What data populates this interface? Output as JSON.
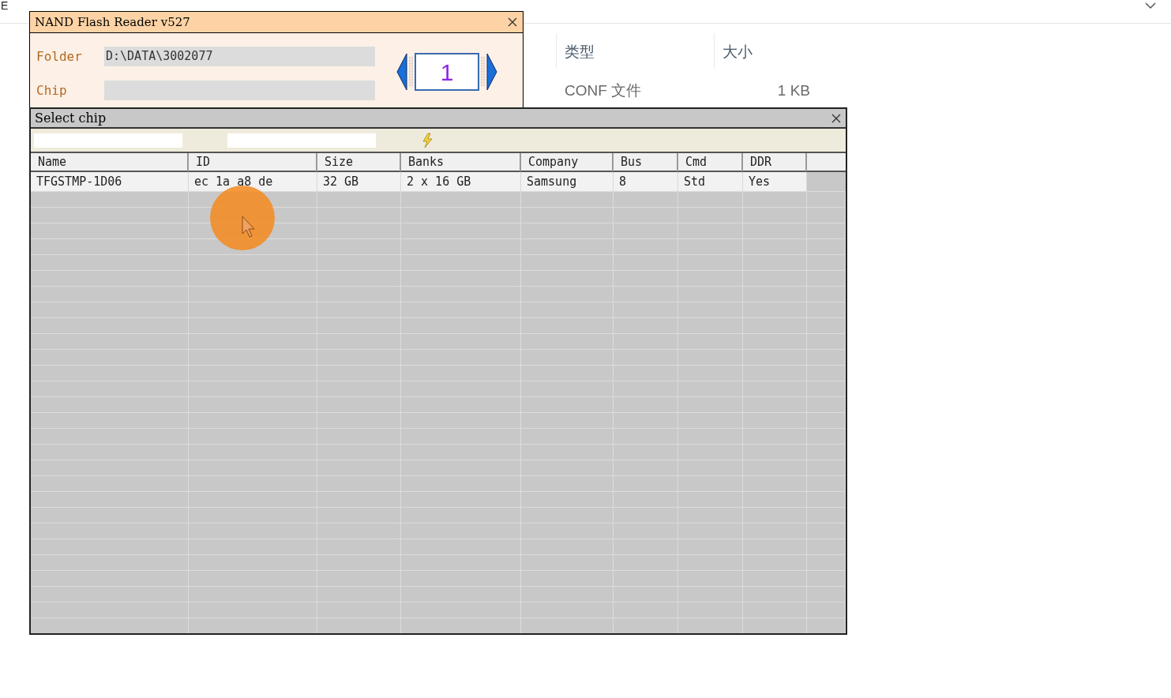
{
  "explorer": {
    "corner_text": "E",
    "columns": [
      {
        "label": "类型"
      },
      {
        "label": "大小"
      }
    ],
    "row": {
      "type": "CONF 文件",
      "size": "1 KB"
    }
  },
  "reader": {
    "title": "NAND Flash Reader v527",
    "folder_label": "Folder",
    "folder": "D:\\DATA\\3002077",
    "chip_label": "Chip",
    "page": "1"
  },
  "select_chip": {
    "title": "Select chip",
    "columns": [
      "Name",
      "ID",
      "Size",
      "Banks",
      "Company",
      "Bus",
      "Cmd",
      "DDR"
    ],
    "rows": [
      {
        "cells": [
          "TFGSTMP-1D06",
          "ec 1a a8 de",
          "32 GB",
          "2 x 16 GB",
          "Samsung",
          "8",
          "Std",
          "Yes"
        ]
      }
    ]
  }
}
